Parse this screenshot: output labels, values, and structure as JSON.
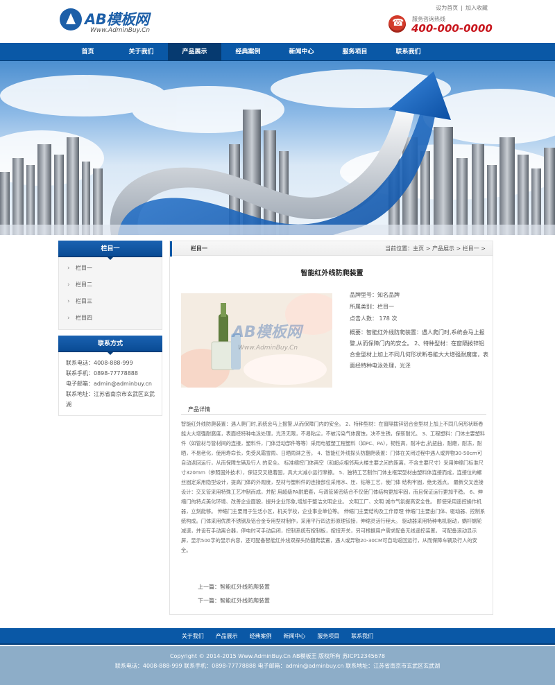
{
  "header": {
    "logo_text": "AB模板网",
    "logo_url": "Www.AdminBuy.Cn",
    "top_links": [
      "设为首页",
      "|",
      "加入收藏"
    ],
    "hotline_label": "服务咨询热线",
    "hotline_number": "400-000-0000"
  },
  "nav": {
    "items": [
      "首页",
      "关于我们",
      "产品展示",
      "经典案例",
      "新闻中心",
      "服务项目",
      "联系我们"
    ],
    "active_index": 2
  },
  "sidebar": {
    "category_title": "栏目一",
    "categories": [
      "栏目一",
      "栏目二",
      "栏目三",
      "栏目四"
    ],
    "contact_title": "联系方式",
    "contact_lines": [
      "联系电话：4008-888-999",
      "联系手机：0898-77778888",
      "电子邮箱：admin@adminbuy.cn",
      "联系地址：江苏省南京市玄武区玄武湖"
    ]
  },
  "content": {
    "section_title": "栏目一",
    "breadcrumb": "当前位置：主页 > 产品展示 > 栏目一 >",
    "product_title": "智能红外线防爬装置",
    "info": {
      "model": "品牌型号：知名品牌",
      "category": "所属类别：栏目一",
      "views": "点击人数： 178 次",
      "summary": "概要：智能红外线防爬装置：遇人爬门时,系统会马上报警,从而保障门内的安全。 2、特种型材：在窗隔拨锌铝合金型材上加上不同几何形状断卷能大大增强耐腐度，表面经特种电泳处理，光泽"
    },
    "image_watermark": "AB模板网",
    "image_watermark_url": "Www.AdminBuy.Cn",
    "detail_heading": "产品详情",
    "detail_text": "智能红外线防爬装置：遇人爬门时,系统会马上报警,从而保障门内的安全。 2、特种型材：在窗隔拨锌铝合金型材上加上不同几何形状断卷能大大增强耐腐度，表面经特种电泳处理，光泽无限，不易粘尘，不被污染气体腐蚀，决不生锈，保新耐光。 3、工程塑料：门体主要塑料件（如管材与管材间的连接，塑料件，门体活动部件等等）采用电镀塑工程塑料（如PC、PA），韧性高，耐冲击,抗扭曲，耐磨，耐冻，耐晒，不易老化，使用寿命长，免受风霜雪雨、日晒雨淋之苦。 4、智能红外线探头防翻爬装置：门体在关闭过程中遇人或异物30-50cm可自动返回运行，从而保障车辆及行人 的安全。 标准缩控门体两空（和超点相邻两大楼主要之间的距离，不含主要尺寸）采用伸缩门标准尺寸320mm（参照国外技术），保证交叉稳着固，具大大减小运行摩擦。 5、独特工艺制作门体主框架型材由塑料体连接而成，连接位的螺丝固定采用隐型设计，提高门体的外观度，型材与塑料件的连接部位采用水、压、钻等工艺，使门体 结构牢固，绝无摇点。 最新交叉连接设计：交叉管采用特殊工艺冲制而成，并配 用超级PA耐磨套，与调管紧密结合不仅使门体结构更加牢固，而且保证运行更加平稳。 6、伸缩门的特点美化环境、改善企业面貌，提升企业形象,增加于整洁文明企业。 文明工厂、文明 城市气氛提高安全性。 即使采用遥控操作机器，立刻能够。 伸缩门主要用于生活小区，机关学校，企业事业单位等。 伸缩门主要结构及工作原理 伸缩门主要由门体、驱动器、控制系统构成。门体采用优质不锈钢及铝合金专用型材制作，采用平行四边形原理铰接，伸缩灵活行程大。 驱动器采用特种电机驱动，蜗杆蜗轮减速，并设有手动离合器，停电时可手动启闭，控制系统有按制板，按扭开关，另可根据用户需求配备无线遥控装置。 可配备滚动显示屏，显示500字的显示内容，还可配备智能红外线双探头防翻爬装置，遇人或异物20-30CM可自动返回运行，从而保障车辆及行人的安全。",
    "prev": "上一篇：智能红外线防爬装置",
    "next": "下一篇：智能红外线防爬装置"
  },
  "footer": {
    "nav": [
      "关于我们",
      "产品展示",
      "经典案例",
      "新闻中心",
      "服务项目",
      "联系我们"
    ],
    "copyright": "Copyright © 2014-2015 Www.AdminBuy.Cn AB模板王 版权所有 苏ICP12345678",
    "contact": "联系电话：4008-888-999 联系手机：0898-77778888 电子邮箱：admin@adminbuy.cn 联系地址：江苏省南京市玄武区玄武湖"
  },
  "colors": {
    "brand_blue": "#0a58a6",
    "hotline_red": "#c8161d",
    "footer_gray_blue": "#8dadc8"
  }
}
